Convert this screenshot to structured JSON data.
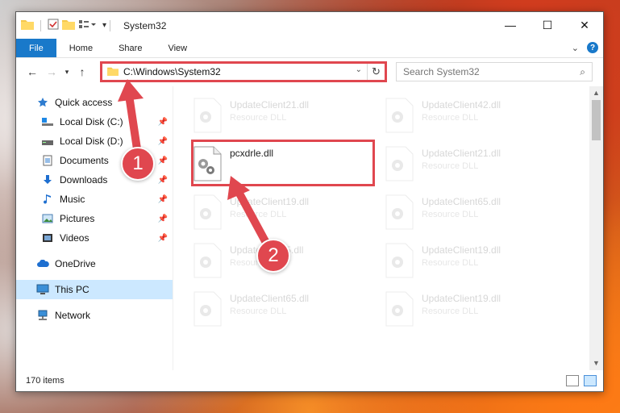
{
  "window": {
    "title": "System32",
    "controls": {
      "minimize": "—",
      "maximize": "☐",
      "close": "✕"
    }
  },
  "ribbon": {
    "tabs": [
      "File",
      "Home",
      "Share",
      "View"
    ],
    "help": "?"
  },
  "nav": {
    "address": "C:\\Windows\\System32",
    "search_placeholder": "Search System32"
  },
  "sidebar": {
    "items": [
      {
        "label": "Quick access",
        "icon": "star-icon"
      },
      {
        "label": "Local Disk (C:)",
        "icon": "drive-icon",
        "pinned": true
      },
      {
        "label": "Local Disk (D:)",
        "icon": "drive-icon",
        "pinned": true
      },
      {
        "label": "Documents",
        "icon": "documents-icon",
        "pinned": true
      },
      {
        "label": "Downloads",
        "icon": "downloads-icon",
        "pinned": true
      },
      {
        "label": "Music",
        "icon": "music-icon",
        "pinned": true
      },
      {
        "label": "Pictures",
        "icon": "pictures-icon",
        "pinned": true
      },
      {
        "label": "Videos",
        "icon": "videos-icon",
        "pinned": true
      },
      {
        "label": "OneDrive",
        "icon": "cloud-icon"
      },
      {
        "label": "This PC",
        "icon": "computer-icon",
        "selected": true
      },
      {
        "label": "Network",
        "icon": "network-icon"
      }
    ]
  },
  "files": {
    "focused": {
      "name": "pcxdrle.dll"
    },
    "left_column": [
      {
        "name": "UpdateClient21.dll",
        "type": "Resource DLL"
      },
      {
        "name": "UpdateClient19.dll",
        "type": "Resource DLL"
      },
      {
        "name": "UpdateClient5.dll",
        "type": "Resource DLL"
      },
      {
        "name": "UpdateClient65.dll",
        "type": "Resource DLL"
      }
    ],
    "right_column": [
      {
        "name": "UpdateClient42.dll",
        "type": "Resource DLL"
      },
      {
        "name": "UpdateClient21.dll",
        "type": "Resource DLL"
      },
      {
        "name": "UpdateClient65.dll",
        "type": "Resource DLL"
      },
      {
        "name": "UpdateClient19.dll",
        "type": "Resource DLL"
      },
      {
        "name": "UpdateClient19.dll",
        "type": "Resource DLL"
      }
    ]
  },
  "status": {
    "count": "170 items"
  },
  "annotations": {
    "step1": "1",
    "step2": "2",
    "color": "#e0474f"
  }
}
